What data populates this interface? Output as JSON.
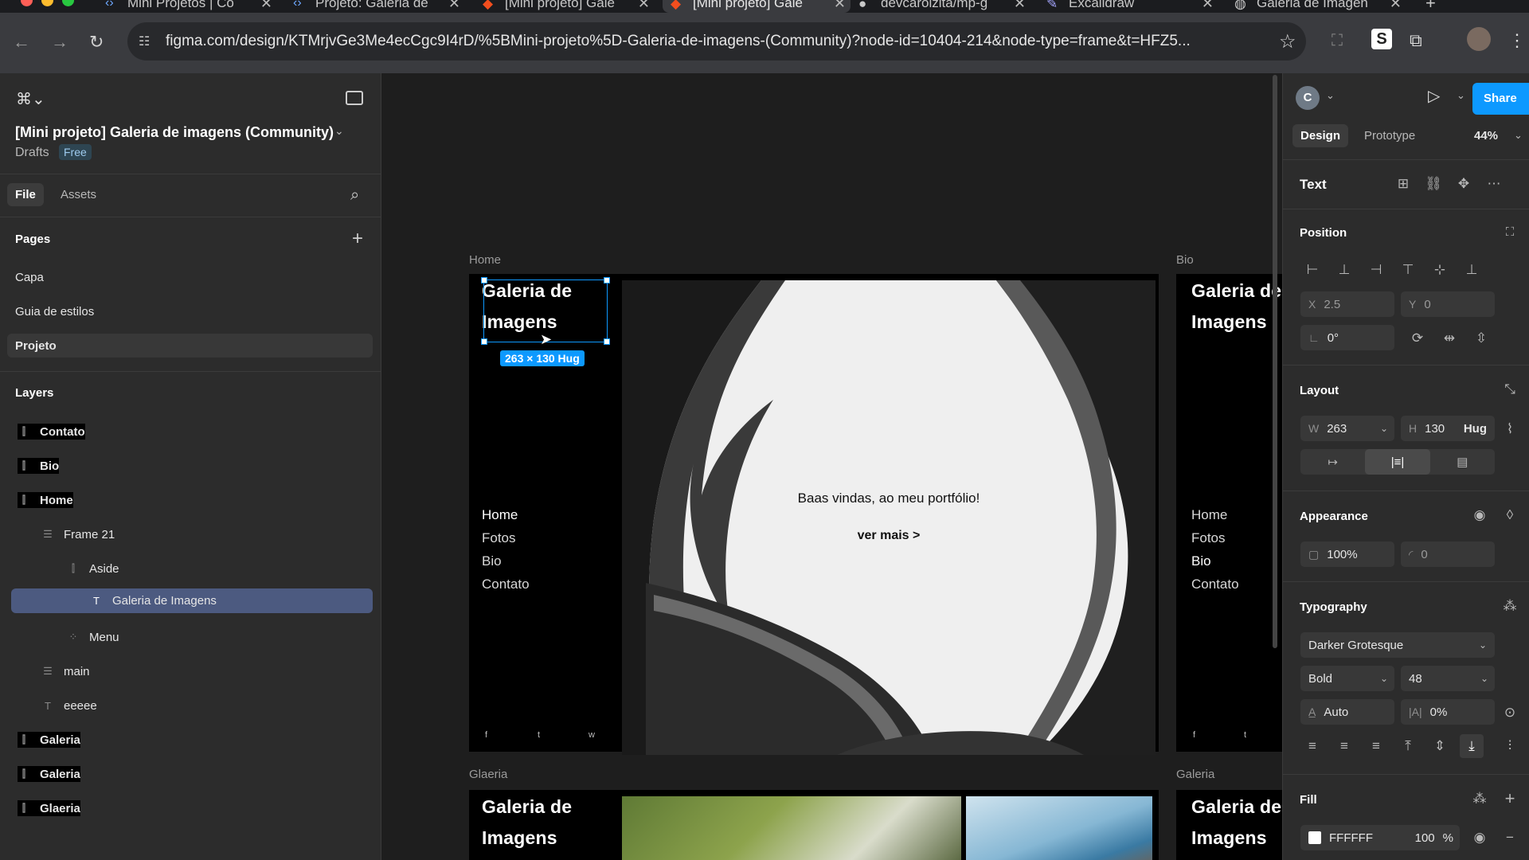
{
  "browser": {
    "tabs": [
      {
        "label": "Mini Projetos | Co"
      },
      {
        "label": "Projeto: Galeria de"
      },
      {
        "label": "[Mini projeto] Gale"
      },
      {
        "label": "[Mini projeto] Gale"
      },
      {
        "label": "devcarolzita/mp-g"
      },
      {
        "label": "Excalidraw"
      },
      {
        "label": "Galeria de Imagen"
      }
    ],
    "url": "figma.com/design/KTMrjvGe3Me4ecCgc9I4rD/%5BMini-projeto%5D-Galeria-de-imagens-(Community)?node-id=10404-214&node-type=frame&t=HFZ5..."
  },
  "sidebar": {
    "file_title": "[Mini projeto] Galeria de imagens (Community)",
    "location": "Drafts",
    "plan_badge": "Free",
    "tab_file": "File",
    "tab_assets": "Assets",
    "pages_heading": "Pages",
    "pages": [
      {
        "label": "Capa"
      },
      {
        "label": "Guia de estilos"
      },
      {
        "label": "Projeto"
      }
    ],
    "layers_heading": "Layers",
    "layers": [
      {
        "label": "Contato"
      },
      {
        "label": "Bio"
      },
      {
        "label": "Home"
      },
      {
        "label": "Frame 21"
      },
      {
        "label": "Aside"
      },
      {
        "label": "Galeria de Imagens"
      },
      {
        "label": "Menu"
      },
      {
        "label": "main"
      },
      {
        "label": "eeeee"
      },
      {
        "label": "Galeria"
      },
      {
        "label": "Galeria"
      },
      {
        "label": "Glaeria"
      }
    ]
  },
  "canvas": {
    "frame_labels": {
      "home": "Home",
      "bio": "Bio",
      "glaeria": "Glaeria",
      "galeria": "Galeria"
    },
    "site_title_line1": "Galeria de",
    "site_title_line2": "Imagens",
    "menu": [
      {
        "label": "Home"
      },
      {
        "label": "Fotos"
      },
      {
        "label": "Bio"
      },
      {
        "label": "Contato"
      }
    ],
    "welcome_text": "Baas vindas, ao meu portfólio!",
    "see_more": "ver mais >",
    "social": [
      "f",
      "t",
      "w"
    ],
    "selection_size": "263 × 130 Hug"
  },
  "props": {
    "zoom": "44%",
    "tab_design": "Design",
    "tab_prototype": "Prototype",
    "share": "Share",
    "avatar_initial": "C",
    "layer_type": "Text",
    "position_heading": "Position",
    "x_label": "X",
    "x_value": "2.5",
    "y_label": "Y",
    "y_value": "0",
    "rotation": "0°",
    "layout_heading": "Layout",
    "w_label": "W",
    "w_value": "263",
    "h_label": "H",
    "h_value": "130",
    "h_mode": "Hug",
    "appearance_heading": "Appearance",
    "opacity": "100%",
    "radius": "0",
    "typography_heading": "Typography",
    "font": "Darker Grotesque",
    "weight": "Bold",
    "size": "48",
    "line_height": "Auto",
    "letter_spacing": "0%",
    "fill_heading": "Fill",
    "fill_hex": "FFFFFF",
    "fill_opacity": "100",
    "fill_pct": "%"
  },
  "colors": {
    "accent": "#0d99ff",
    "selection": "#4c5a80"
  }
}
